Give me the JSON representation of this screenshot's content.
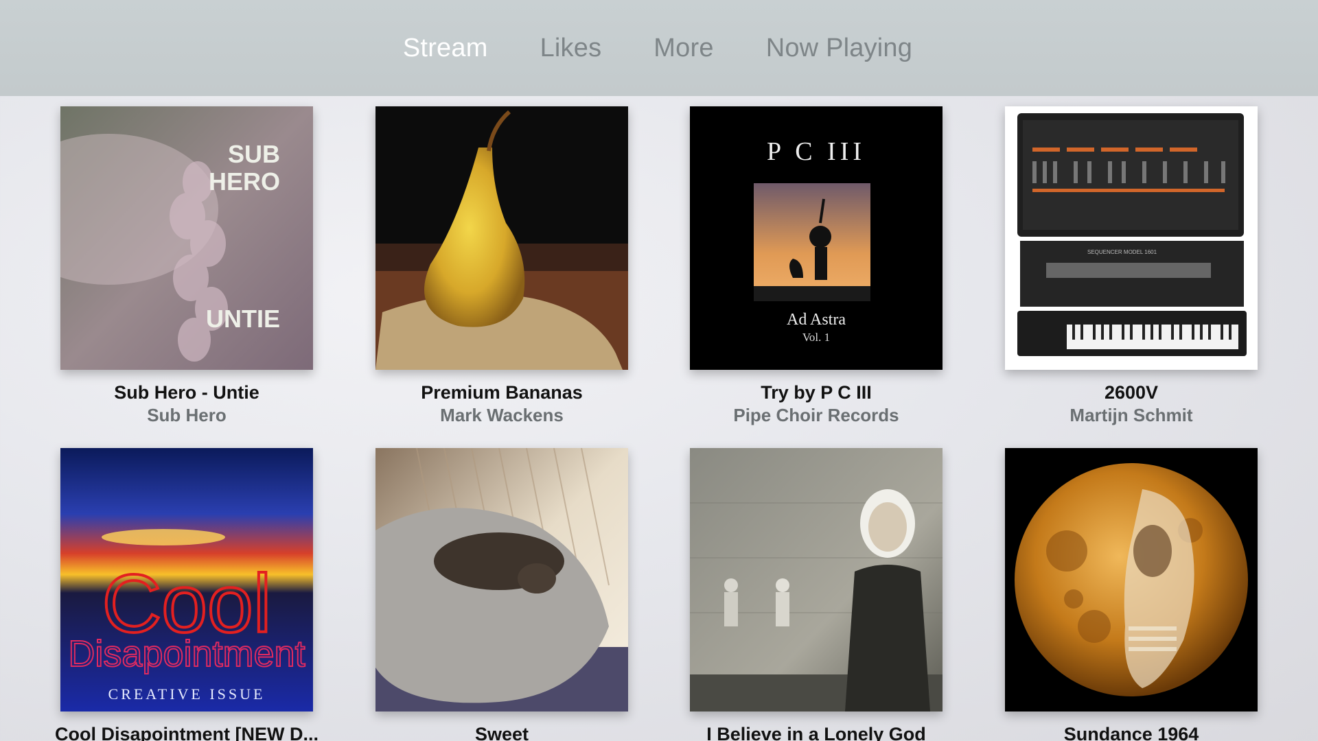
{
  "nav": {
    "tabs": [
      {
        "label": "Stream",
        "active": true
      },
      {
        "label": "Likes",
        "active": false
      },
      {
        "label": "More",
        "active": false
      },
      {
        "label": "Now Playing",
        "active": false
      }
    ]
  },
  "tracks": [
    {
      "title": "Sub Hero - Untie",
      "artist": "Sub Hero",
      "art_text": [
        "SUB",
        "HERO",
        "UNTIE"
      ]
    },
    {
      "title": "Premium Bananas",
      "artist": "Mark Wackens"
    },
    {
      "title": "Try by P C III",
      "artist": "Pipe Choir Records",
      "art_text": [
        "P C III",
        "Ad Astra",
        "Vol. 1"
      ]
    },
    {
      "title": "2600V",
      "artist": "Martijn Schmit",
      "art_text": [
        "SEQUENCER MODEL 1601"
      ]
    },
    {
      "title": "Cool Disapointment [NEW D...",
      "artist": "",
      "art_text": [
        "Cool",
        "Disapointment",
        "CREATIVE ISSUE"
      ]
    },
    {
      "title": "Sweet",
      "artist": ""
    },
    {
      "title": "I Believe in a Lonely God",
      "artist": ""
    },
    {
      "title": "Sundance 1964",
      "artist": ""
    }
  ],
  "colors": {
    "nav_bg": "#c6cdcf",
    "tab_active": "#ffffff",
    "tab_inactive": "#7e8588"
  }
}
